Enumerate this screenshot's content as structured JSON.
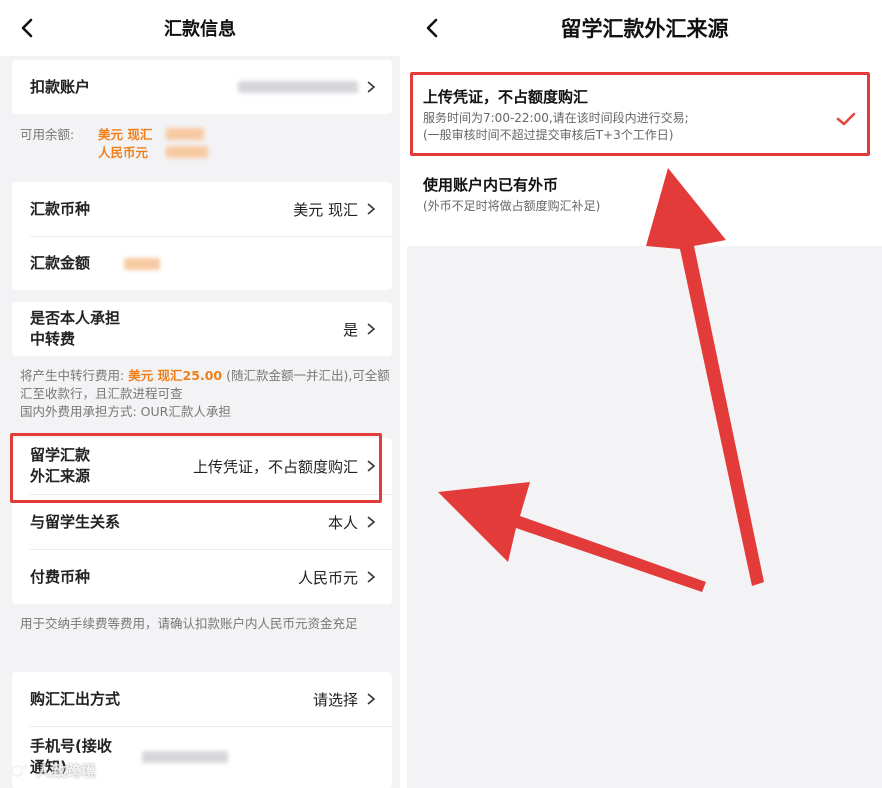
{
  "left": {
    "title": "汇款信息",
    "debit_account": {
      "label": "扣款账户"
    },
    "balance": {
      "label": "可用余额:",
      "usd": "美元 现汇",
      "cny": "人民币元"
    },
    "currency": {
      "label": "汇款币种",
      "value": "美元 现汇"
    },
    "amount": {
      "label": "汇款金额"
    },
    "bear_fee": {
      "label_line1": "是否本人承担",
      "label_line2": "中转费",
      "value": "是"
    },
    "fee_note": {
      "prefix": "将产生中转行费用:",
      "amount": "美元 现汇25.00",
      "suffix": "(随汇款金额一并汇出),可全额汇至收款行，且汇款进程可查",
      "line3": "国内外费用承担方式: OUR汇款人承担"
    },
    "source": {
      "label_line1": "留学汇款",
      "label_line2": "外汇来源",
      "value": "上传凭证，不占额度购汇"
    },
    "relation": {
      "label": "与留学生关系",
      "value": "本人"
    },
    "pay_currency": {
      "label": "付费币种",
      "value": "人民币元"
    },
    "pay_note": "用于交纳手续费等费用，请确认扣款账户内人民币元资金充足",
    "method": {
      "label": "购汇汇出方式",
      "value": "请选择"
    },
    "phone": {
      "label_line1": "手机号(接收",
      "label_line2": "通知)"
    }
  },
  "right": {
    "title": "留学汇款外汇来源",
    "options": [
      {
        "title": "上传凭证，不占额度购汇",
        "desc1": "服务时间为7:00-22:00,请在该时间段内进行交易;",
        "desc2": "(一般审核时间不超过提交审核后T+3个工作日)",
        "selected": true
      },
      {
        "title": "使用账户内已有外币",
        "desc1": "(外币不足时将做占额度购汇补足)",
        "selected": false
      }
    ]
  },
  "watermark": "人致跨境",
  "colors": {
    "accent_orange": "#f07f1a",
    "highlight_red": "#e33a3a",
    "check_red": "#e2473d",
    "bg": "#f3f3f5"
  },
  "icons": {
    "back": "chevron-left-icon",
    "row_arrow": "chevron-right-icon",
    "selected": "check-icon"
  }
}
